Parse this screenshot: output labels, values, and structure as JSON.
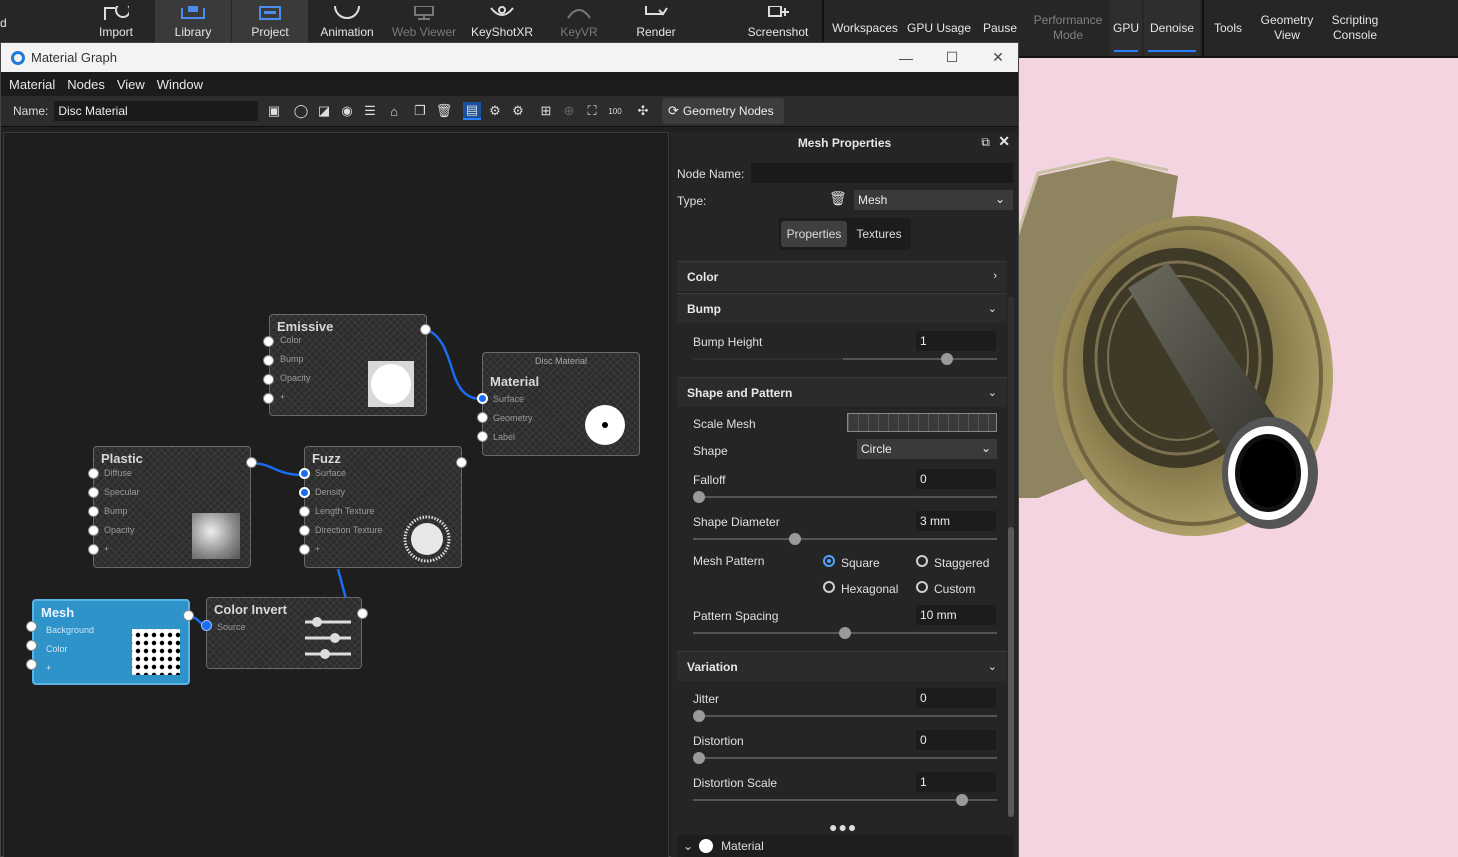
{
  "toolbar": {
    "left_stub": "d",
    "items": [
      "Import",
      "Library",
      "Project",
      "Animation",
      "Web Viewer",
      "KeyShotXR",
      "KeyVR",
      "Render",
      "Screenshot"
    ],
    "right_items": [
      "Workspaces",
      "GPU Usage",
      "Pause",
      "Performance Mode",
      "GPU",
      "Denoise",
      "Tools",
      "Geometry View",
      "Scripting Console"
    ]
  },
  "window": {
    "title": "Material Graph",
    "menu": [
      "Material",
      "Nodes",
      "View",
      "Window"
    ],
    "name_label": "Name:",
    "name_value": "Disc Material",
    "geometry_nodes_label": "Geometry Nodes"
  },
  "graph": {
    "emissive": {
      "title": "Emissive",
      "ports": [
        "Color",
        "Bump",
        "Opacity",
        "+"
      ]
    },
    "disc": {
      "header": "Disc Material",
      "title": "Material",
      "ports": [
        "Surface",
        "Geometry",
        "Label"
      ]
    },
    "plastic": {
      "title": "Plastic",
      "ports": [
        "Diffuse",
        "Specular",
        "Bump",
        "Opacity",
        "+"
      ]
    },
    "fuzz": {
      "title": "Fuzz",
      "ports": [
        "Surface",
        "Density",
        "Length Texture",
        "Direction Texture",
        "+"
      ]
    },
    "mesh": {
      "title": "Mesh",
      "ports": [
        "Background",
        "Color",
        "+"
      ]
    },
    "color_invert": {
      "title": "Color Invert",
      "ports": [
        "Source"
      ]
    }
  },
  "properties": {
    "title": "Mesh Properties",
    "node_name_label": "Node Name:",
    "node_name_value": "",
    "type_label": "Type:",
    "type_value": "Mesh",
    "tabs": [
      "Properties",
      "Textures"
    ],
    "sections": {
      "color": "Color",
      "bump": "Bump",
      "shape_pattern": "Shape and Pattern",
      "variation": "Variation"
    },
    "bump_height": {
      "label": "Bump Height",
      "value": "1",
      "level": 0.85
    },
    "scale_mesh_label": "Scale Mesh",
    "shape": {
      "label": "Shape",
      "value": "Circle"
    },
    "falloff": {
      "label": "Falloff",
      "value": "0",
      "level": 0.0
    },
    "shape_diameter": {
      "label": "Shape Diameter",
      "value": "3 mm",
      "level": 0.33
    },
    "mesh_pattern": {
      "label": "Mesh Pattern",
      "options": [
        "Square",
        "Staggered",
        "Hexagonal",
        "Custom"
      ],
      "selected": "Square"
    },
    "pattern_spacing": {
      "label": "Pattern Spacing",
      "value": "10 mm",
      "level": 0.5
    },
    "jitter": {
      "label": "Jitter",
      "value": "0",
      "level": 0.0
    },
    "distortion": {
      "label": "Distortion",
      "value": "0",
      "level": 0.0
    },
    "distortion_scale": {
      "label": "Distortion Scale",
      "value": "1",
      "level": 0.9
    },
    "footer_label": "Material"
  },
  "colors": {
    "accent": "#2a7fff",
    "mesh_node": "#2e93c9",
    "viewport_bg": "#f4d4e1"
  }
}
